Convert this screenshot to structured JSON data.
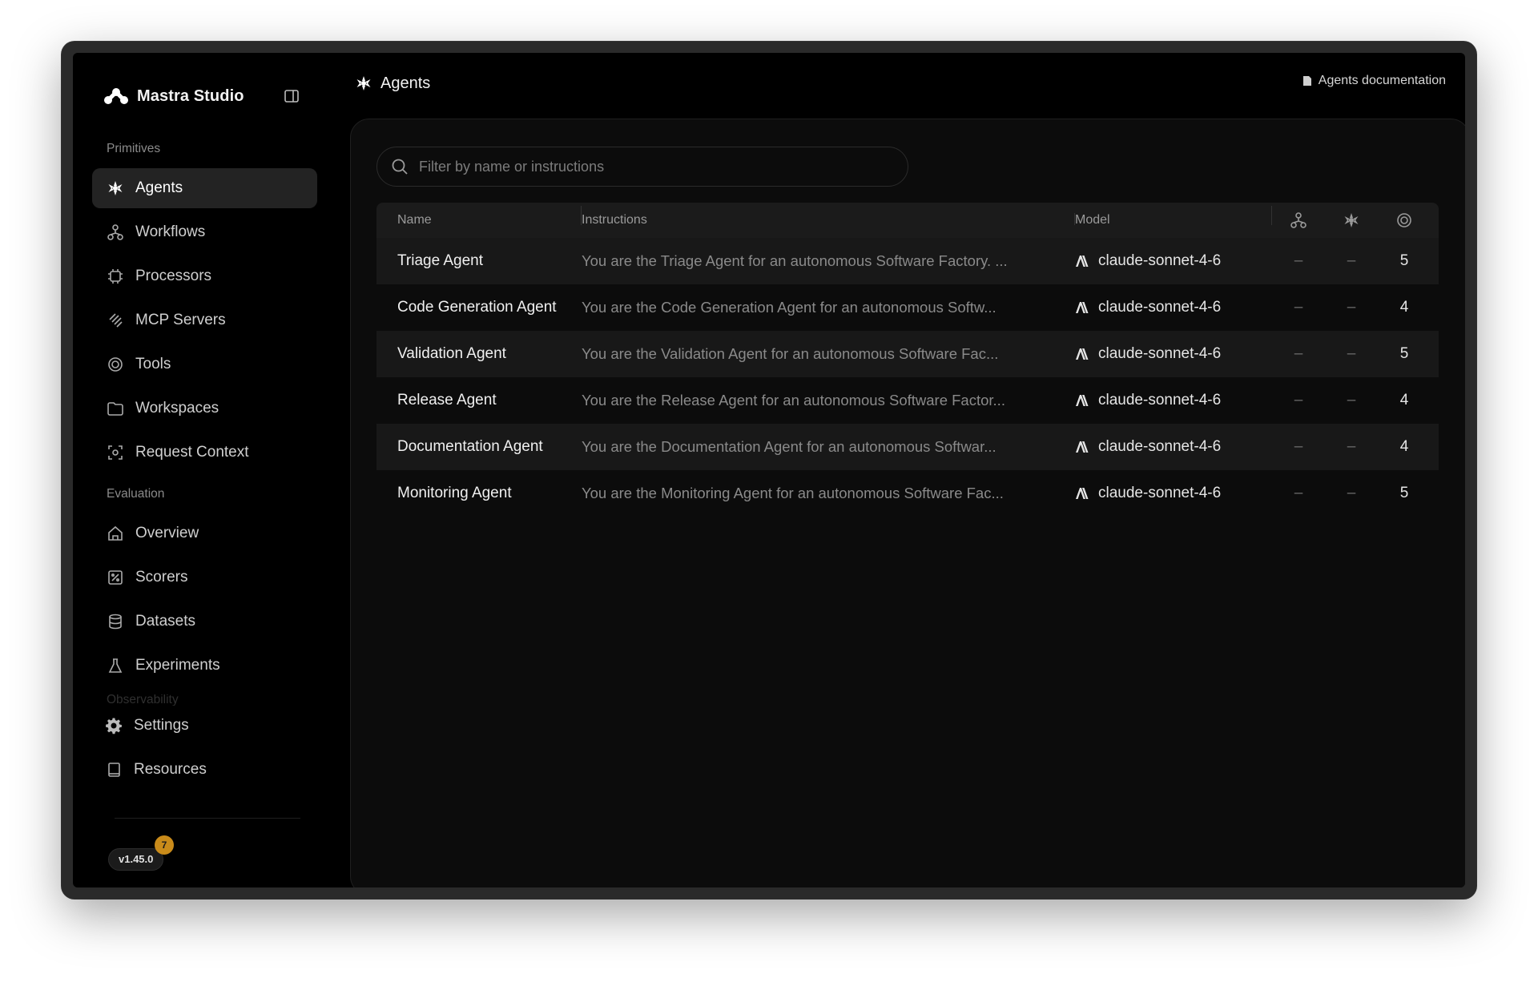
{
  "app": {
    "brand_name": "Mastra Studio"
  },
  "sidebar": {
    "sections": {
      "primitives": "Primitives",
      "evaluation": "Evaluation",
      "observability": "Observability"
    },
    "primitives_items": [
      {
        "label": "Agents",
        "icon": "agents-icon",
        "active": true
      },
      {
        "label": "Workflows",
        "icon": "workflows-icon"
      },
      {
        "label": "Processors",
        "icon": "processors-icon"
      },
      {
        "label": "MCP Servers",
        "icon": "mcp-servers-icon"
      },
      {
        "label": "Tools",
        "icon": "tools-icon"
      },
      {
        "label": "Workspaces",
        "icon": "folder-icon"
      },
      {
        "label": "Request Context",
        "icon": "request-context-icon"
      }
    ],
    "evaluation_items": [
      {
        "label": "Overview",
        "icon": "home-icon"
      },
      {
        "label": "Scorers",
        "icon": "scorers-icon"
      },
      {
        "label": "Datasets",
        "icon": "database-icon"
      },
      {
        "label": "Experiments",
        "icon": "flask-icon"
      }
    ],
    "footer_items": [
      {
        "label": "Settings",
        "icon": "gear-icon"
      },
      {
        "label": "Resources",
        "icon": "book-icon"
      }
    ],
    "version": "v1.45.0",
    "version_badge": "7"
  },
  "header": {
    "title": "Agents",
    "doc_link": "Agents documentation"
  },
  "search": {
    "placeholder": "Filter by name or instructions"
  },
  "table": {
    "columns": {
      "name": "Name",
      "instructions": "Instructions",
      "model": "Model"
    },
    "icon_columns": [
      "workflows-icon",
      "agents-icon",
      "tools-icon"
    ],
    "rows": [
      {
        "name": "Triage Agent",
        "instructions": "You are the Triage Agent for an autonomous Software Factory. ...",
        "model": "claude-sonnet-4-6",
        "workflows": "–",
        "agents": "–",
        "tools": "5"
      },
      {
        "name": "Code Generation Agent",
        "instructions": "You are the Code Generation Agent for an autonomous Softw...",
        "model": "claude-sonnet-4-6",
        "workflows": "–",
        "agents": "–",
        "tools": "4"
      },
      {
        "name": "Validation Agent",
        "instructions": "You are the Validation Agent for an autonomous Software Fac...",
        "model": "claude-sonnet-4-6",
        "workflows": "–",
        "agents": "–",
        "tools": "5"
      },
      {
        "name": "Release Agent",
        "instructions": "You are the Release Agent for an autonomous Software Factor...",
        "model": "claude-sonnet-4-6",
        "workflows": "–",
        "agents": "–",
        "tools": "4"
      },
      {
        "name": "Documentation Agent",
        "instructions": "You are the Documentation Agent for an autonomous Softwar...",
        "model": "claude-sonnet-4-6",
        "workflows": "–",
        "agents": "–",
        "tools": "4"
      },
      {
        "name": "Monitoring Agent",
        "instructions": "You are the Monitoring Agent for an autonomous Software Fac...",
        "model": "claude-sonnet-4-6",
        "workflows": "–",
        "agents": "–",
        "tools": "5"
      }
    ]
  }
}
